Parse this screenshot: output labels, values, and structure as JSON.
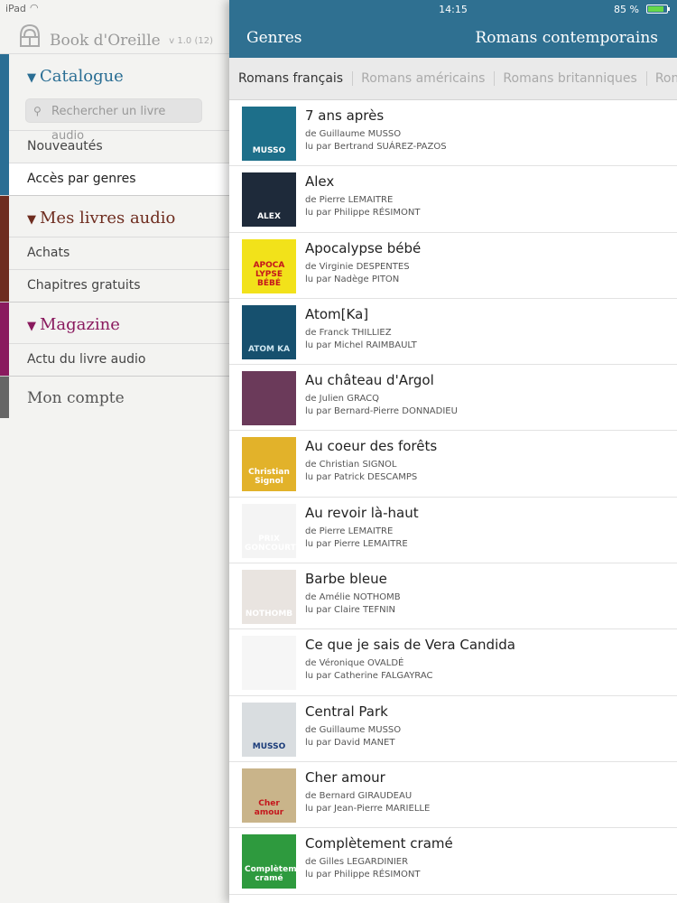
{
  "status": {
    "carrier": "iPad",
    "time": "14:15",
    "battery": "85 %"
  },
  "sidebar": {
    "brand": "Book d'Oreille",
    "version": "v 1.0 (12)",
    "catalogue": {
      "title": "Catalogue",
      "search_placeholder": "Rechercher un livre audio",
      "items": [
        "Nouveautés",
        "Accès par genres"
      ]
    },
    "mes_livres": {
      "title": "Mes livres audio",
      "items": [
        "Achats",
        "Chapitres gratuits"
      ]
    },
    "magazine": {
      "title": "Magazine",
      "items": [
        "Actu du livre audio"
      ]
    },
    "account": "Mon compte"
  },
  "colors": {
    "catalogue": "#2a6e94",
    "mes_livres": "#6e2c1f",
    "magazine": "#8a1a5e",
    "account": "#666666",
    "header": "#2f7091"
  },
  "header": {
    "back_label": "Genres",
    "title": "Romans contemporains"
  },
  "tabs": [
    "Romans français",
    "Romans américains",
    "Romans britanniques",
    "Romans"
  ],
  "books": [
    {
      "title": "7 ans après",
      "author": "de Guillaume  MUSSO",
      "reader": "lu par Bertrand SUÁREZ-PAZOS"
    },
    {
      "title": "Alex",
      "author": "de Pierre LEMAITRE",
      "reader": "lu par Philippe RÉSIMONT"
    },
    {
      "title": "Apocalypse bébé",
      "author": "de Virginie DESPENTES",
      "reader": "lu par Nadège PITON"
    },
    {
      "title": "Atom[Ka]",
      "author": "de Franck THILLIEZ",
      "reader": "lu par Michel RAIMBAULT"
    },
    {
      "title": "Au château d'Argol",
      "author": "de Julien GRACQ",
      "reader": "lu par Bernard-Pierre DONNADIEU"
    },
    {
      "title": "Au coeur des forêts",
      "author": "de Christian SIGNOL",
      "reader": "lu par Patrick DESCAMPS"
    },
    {
      "title": "Au revoir là-haut",
      "author": "de Pierre LEMAITRE",
      "reader": "lu par Pierre LEMAITRE"
    },
    {
      "title": "Barbe bleue",
      "author": "de Amélie NOTHOMB",
      "reader": "lu par Claire TEFNIN"
    },
    {
      "title": "Ce que je sais de Vera Candida",
      "author": "de Véronique OVALDÉ",
      "reader": "lu par Catherine FALGAYRAC"
    },
    {
      "title": "Central Park",
      "author": "de Guillaume  MUSSO",
      "reader": "lu par David MANET"
    },
    {
      "title": "Cher amour",
      "author": "de Bernard GIRAUDEAU",
      "reader": "lu par Jean-Pierre MARIELLE"
    },
    {
      "title": "Complètement cramé",
      "author": "de Gilles LEGARDINIER",
      "reader": "lu par Philippe RÉSIMONT"
    }
  ],
  "covers": [
    {
      "text": "MUSSO",
      "bg": "#1d6f8a",
      "fg": "#ffffff"
    },
    {
      "text": "ALEX",
      "bg": "#1e2a3a",
      "fg": "#ffffff"
    },
    {
      "text": "APOCA LYPSE BÉBÉ",
      "bg": "#f2e21a",
      "fg": "#c4161c"
    },
    {
      "text": "ATOM KA",
      "bg": "#16506e",
      "fg": "#cfe6f0"
    },
    {
      "text": "",
      "bg": "#6b3a5a",
      "fg": "#ffffff"
    },
    {
      "text": "Christian Signol",
      "bg": "#e2b22a",
      "fg": "#ffffff"
    },
    {
      "text": "PRIX GONCOURT",
      "bg": "#f4f4f4",
      "fg": "#ffffff"
    },
    {
      "text": "NOTHOMB",
      "bg": "#e9e4e0",
      "fg": "#ffffff"
    },
    {
      "text": "",
      "bg": "#f6f6f6",
      "fg": "#333333"
    },
    {
      "text": "MUSSO",
      "bg": "#d9dde0",
      "fg": "#1b3c7a"
    },
    {
      "text": "Cher amour",
      "bg": "#c9b48a",
      "fg": "#c4161c"
    },
    {
      "text": "Complètement cramé",
      "bg": "#2e9a3e",
      "fg": "#ffffff"
    }
  ]
}
